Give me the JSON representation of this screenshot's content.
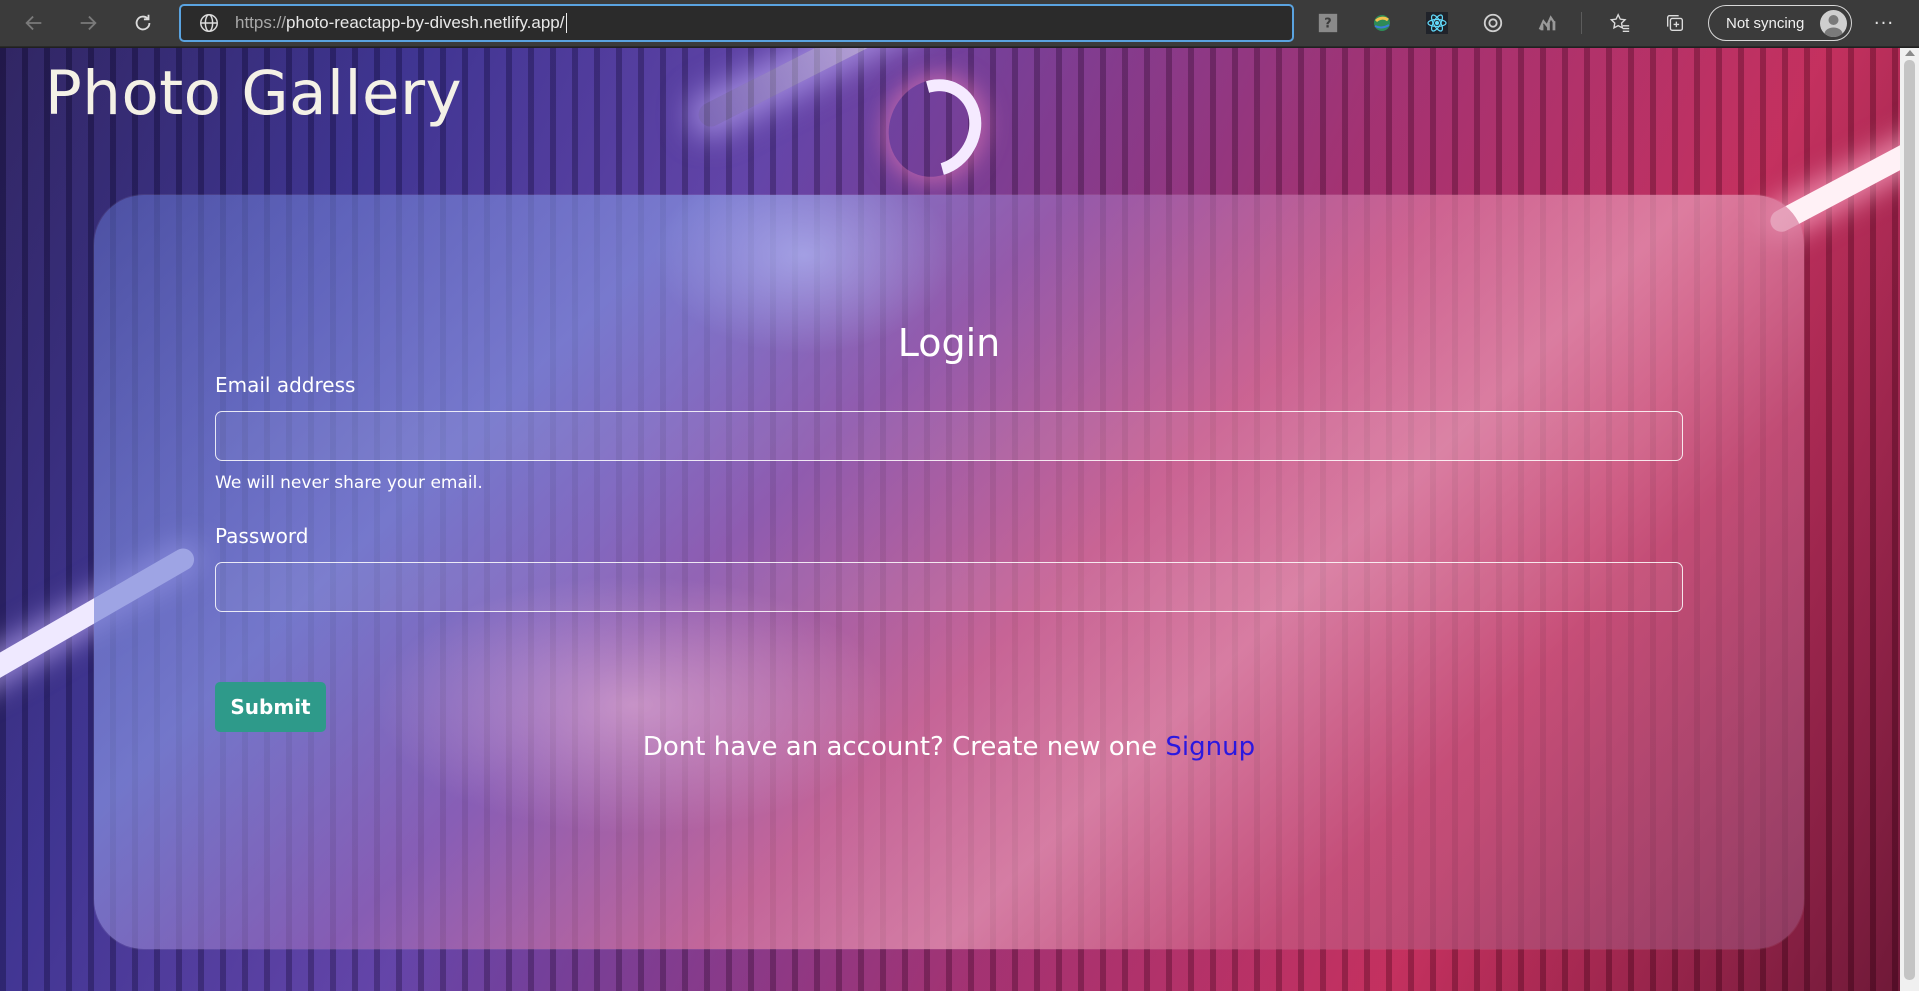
{
  "browser": {
    "url_scheme": "https://",
    "url_rest": "photo-reactapp-by-divesh.netlify.app/",
    "sync_label": "Not syncing",
    "more_label": "···"
  },
  "page": {
    "brand": "Photo Gallery",
    "login": {
      "title": "Login",
      "email_label": "Email address",
      "email_value": "",
      "email_help": "We will never share your email.",
      "password_label": "Password",
      "password_value": "",
      "submit_label": "Submit",
      "signup_prompt": "Dont have an account? Create new one ",
      "signup_link": "Signup"
    }
  },
  "colors": {
    "accent_focus": "#5aa3e0",
    "submit_bg": "#2e9a8a",
    "signup_link": "#2b18e0"
  }
}
